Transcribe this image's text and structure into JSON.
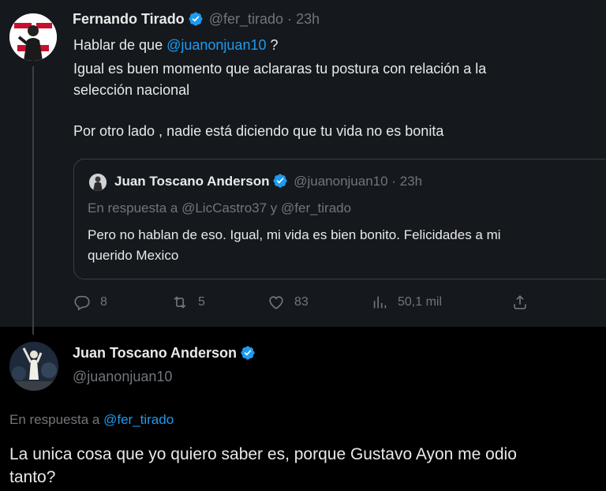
{
  "tweet": {
    "author_name": "Fernando Tirado",
    "author_handle": "@fer_tirado",
    "time_sep": "·",
    "time": "23h",
    "text_prefix": "Hablar de que ",
    "text_mention": "@juanonjuan10",
    "text_suffix": " ?",
    "line2": "Igual es buen momento que aclararas tu postura con relación a la",
    "line3": "selección nacional",
    "line4": "Por otro lado , nadie está diciendo que tu vida no es bonita",
    "quoted": {
      "author_name": "Juan Toscano Anderson",
      "author_handle": "@juanonjuan10",
      "time_sep": "·",
      "time": "23h",
      "reply_to_prefix": "En respuesta a",
      "reply_to_users": "@LicCastro37 y @fer_tirado",
      "line1": "Pero no hablan de eso. Igual, mi vida es bien bonito. Felicidades a mi",
      "line2": "querido Mexico"
    },
    "actions": {
      "replies": "8",
      "retweets": "5",
      "likes": "83",
      "views": "50,1 mil"
    }
  },
  "reply": {
    "author_name": "Juan Toscano Anderson",
    "author_handle": "@juanonjuan10",
    "reply_to_prefix": "En respuesta a",
    "reply_to_user": "@fer_tirado",
    "line1": "La unica cosa que yo quiero saber es, porque Gustavo Ayon me odio",
    "line2": "tanto?"
  },
  "colors": {
    "accent": "#1d9bf0",
    "muted": "#71767b",
    "card_bg": "#15181c",
    "page_bg": "#000000"
  }
}
